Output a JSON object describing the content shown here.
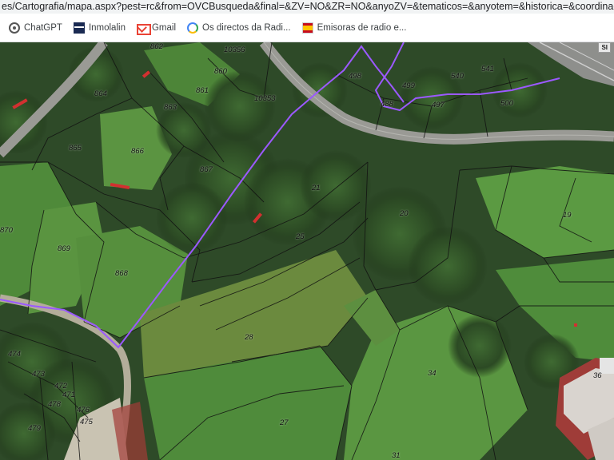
{
  "browser": {
    "url": "es/Cartografia/mapa.aspx?pest=rc&from=OVCBusqueda&final=&ZV=NO&ZR=NO&anyoZV=&tematicos=&anyotem=&historica=&coordinadas=&antecedentes",
    "bookmarks": [
      {
        "label": "ChatGPT",
        "icon": "chatgpt-icon"
      },
      {
        "label": "Inmolalin",
        "icon": "inmolalin-icon"
      },
      {
        "label": "Gmail",
        "icon": "gmail-icon"
      },
      {
        "label": "Os directos da Radi...",
        "icon": "google-icon"
      },
      {
        "label": "Emisoras de radio e...",
        "icon": "spain-flag-icon"
      }
    ]
  },
  "map": {
    "corner_badge": "SI",
    "parcel_labels": [
      {
        "id": "862"
      },
      {
        "id": "10356"
      },
      {
        "id": "860"
      },
      {
        "id": "864"
      },
      {
        "id": "861"
      },
      {
        "id": "863"
      },
      {
        "id": "10353"
      },
      {
        "id": "866"
      },
      {
        "id": "865"
      },
      {
        "id": "867"
      },
      {
        "id": "870"
      },
      {
        "id": "869"
      },
      {
        "id": "868"
      },
      {
        "id": "21"
      },
      {
        "id": "25"
      },
      {
        "id": "28"
      },
      {
        "id": "20"
      },
      {
        "id": "19"
      },
      {
        "id": "34"
      },
      {
        "id": "27"
      },
      {
        "id": "31"
      },
      {
        "id": "36"
      },
      {
        "id": "498"
      },
      {
        "id": "499"
      },
      {
        "id": "540"
      },
      {
        "id": "541"
      },
      {
        "id": "488"
      },
      {
        "id": "497"
      },
      {
        "id": "500"
      },
      {
        "id": "474"
      },
      {
        "id": "473"
      },
      {
        "id": "472"
      },
      {
        "id": "471"
      },
      {
        "id": "476"
      },
      {
        "id": "475"
      },
      {
        "id": "478"
      },
      {
        "id": "479"
      }
    ]
  }
}
